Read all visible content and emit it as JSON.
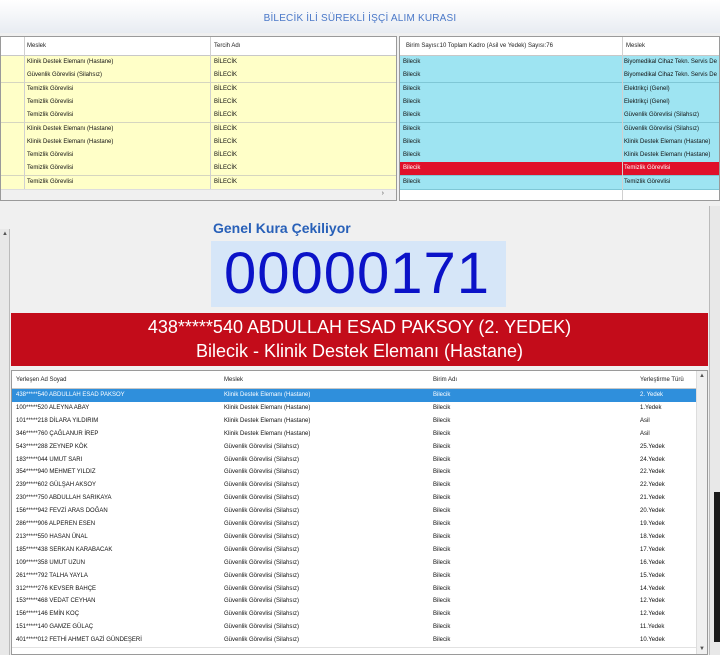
{
  "title": "BİLECİK İLİ SÜREKLİ İŞÇİ ALIM KURASI",
  "top_left": {
    "headers": [
      "Meslek",
      "Tercih Adı"
    ],
    "rows": [
      [
        "Klinik Destek Elemanı (Hastane)",
        "BİLECİK"
      ],
      [
        "Güvenlik Görevlisi (Silahsız)",
        "BİLECİK"
      ],
      [
        "Temizlik Görevlisi",
        "BİLECİK"
      ],
      [
        "Temizlik Görevlisi",
        "BİLECİK"
      ],
      [
        "Temizlik Görevlisi",
        "BİLECİK"
      ],
      [
        "Klinik Destek Elemanı (Hastane)",
        "BİLECİK"
      ],
      [
        "Klinik Destek Elemanı (Hastane)",
        "BİLECİK"
      ],
      [
        "Temizlik Görevlisi",
        "BİLECİK"
      ],
      [
        "Temizlik Görevlisi",
        "BİLECİK"
      ],
      [
        "Temizlik Görevlisi",
        "BİLECİK"
      ]
    ]
  },
  "top_right": {
    "headers": [
      "Birim Sayısı:10 Toplam Kadro (Asil ve Yedek) Sayısı:76",
      "Meslek"
    ],
    "rows": [
      [
        "Bilecik",
        "Biyomedikal Cihaz Tekn. Servis De"
      ],
      [
        "Bilecik",
        "Biyomedikal Cihaz Tekn. Servis De"
      ],
      [
        "Bilecik",
        "Elektrikçi (Genel)"
      ],
      [
        "Bilecik",
        "Elektrikçi (Genel)"
      ],
      [
        "Bilecik",
        "Güvenlik Görevlisi (Silahsız)"
      ],
      [
        "Bilecik",
        "Güvenlik Görevlisi (Silahsız)"
      ],
      [
        "Bilecik",
        "Klinik Destek Elemanı (Hastane)"
      ],
      [
        "Bilecik",
        "Klinik Destek Elemanı (Hastane)"
      ],
      [
        "Bilecik",
        "Temizlik Görevlisi"
      ],
      [
        "Bilecik",
        "Temizlik Görevlisi"
      ]
    ],
    "selected_index": 8
  },
  "kura_label": "Genel Kura Çekiliyor",
  "counter": "00000171",
  "banner": {
    "line1": "438*****540 ABDULLAH ESAD PAKSOY (2. YEDEK)",
    "line2": "Bilecik - Klinik Destek Elemanı (Hastane)"
  },
  "bottom": {
    "headers": [
      "Yerleşen Ad Soyad",
      "Meslek",
      "Birim Adı",
      "Yerleştirme Türü"
    ],
    "rows": [
      [
        "438*****540 ABDULLAH ESAD PAKSOY",
        "Klinik Destek Elemanı (Hastane)",
        "Bilecik",
        "2. Yedek"
      ],
      [
        "100*****520 ALEYNA ABAY",
        "Klinik Destek Elemanı (Hastane)",
        "Bilecik",
        "1.Yedek"
      ],
      [
        "101*****218 DİLARA YILDIRIM",
        "Klinik Destek Elemanı (Hastane)",
        "Bilecik",
        "Asil"
      ],
      [
        "346*****760 ÇAĞLANUR İREP",
        "Klinik Destek Elemanı (Hastane)",
        "Bilecik",
        "Asil"
      ],
      [
        "543*****288 ZEYNEP KÖK",
        "Güvenlik Görevlisi (Silahsız)",
        "Bilecik",
        "25.Yedek"
      ],
      [
        "183*****044 UMUT SARI",
        "Güvenlik Görevlisi (Silahsız)",
        "Bilecik",
        "24.Yedek"
      ],
      [
        "354*****940 MEHMET YILDIZ",
        "Güvenlik Görevlisi (Silahsız)",
        "Bilecik",
        "22.Yedek"
      ],
      [
        "239*****602 GÜLŞAH AKSOY",
        "Güvenlik Görevlisi (Silahsız)",
        "Bilecik",
        "22.Yedek"
      ],
      [
        "230*****750 ABDULLAH SARIKAYA",
        "Güvenlik Görevlisi (Silahsız)",
        "Bilecik",
        "21.Yedek"
      ],
      [
        "156*****942 FEVZİ ARAS DOĞAN",
        "Güvenlik Görevlisi (Silahsız)",
        "Bilecik",
        "20.Yedek"
      ],
      [
        "286*****906 ALPEREN ESEN",
        "Güvenlik Görevlisi (Silahsız)",
        "Bilecik",
        "19.Yedek"
      ],
      [
        "213*****550 HASAN ÜNAL",
        "Güvenlik Görevlisi (Silahsız)",
        "Bilecik",
        "18.Yedek"
      ],
      [
        "185*****438 SERKAN KARABACAK",
        "Güvenlik Görevlisi (Silahsız)",
        "Bilecik",
        "17.Yedek"
      ],
      [
        "109*****358 UMUT UZUN",
        "Güvenlik Görevlisi (Silahsız)",
        "Bilecik",
        "16.Yedek"
      ],
      [
        "261*****792 TALHA YAYLA",
        "Güvenlik Görevlisi (Silahsız)",
        "Bilecik",
        "15.Yedek"
      ],
      [
        "312*****276 KEVSER BAHÇE",
        "Güvenlik Görevlisi (Silahsız)",
        "Bilecik",
        "14.Yedek"
      ],
      [
        "153*****468 VEDAT CEYHAN",
        "Güvenlik Görevlisi (Silahsız)",
        "Bilecik",
        "12.Yedek"
      ],
      [
        "156*****146 EMİN KOÇ",
        "Güvenlik Görevlisi (Silahsız)",
        "Bilecik",
        "12.Yedek"
      ],
      [
        "151*****140 GAMZE GÜLAÇ",
        "Güvenlik Görevlisi (Silahsız)",
        "Bilecik",
        "11.Yedek"
      ],
      [
        "401*****012 FETHİ AHMET GAZİ GÜNDEŞERİ",
        "Güvenlik Görevlisi (Silahsız)",
        "Bilecik",
        "10.Yedek"
      ]
    ],
    "selected_index": 0
  }
}
